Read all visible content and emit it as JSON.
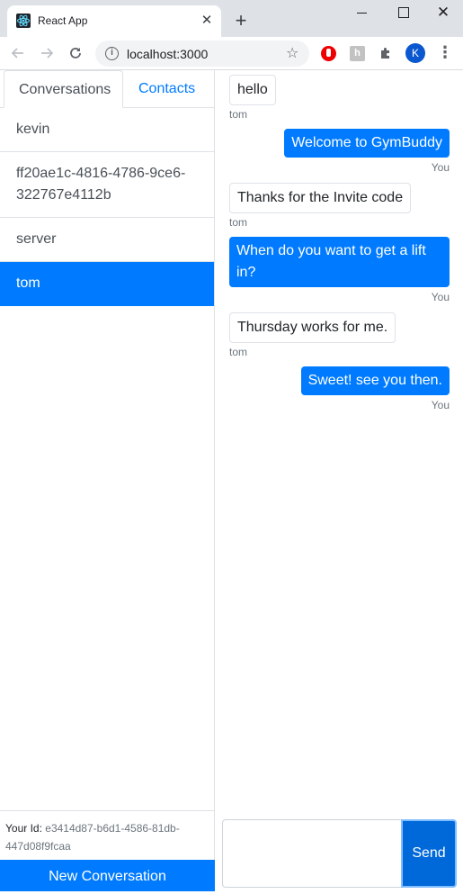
{
  "browser": {
    "tab_title": "React App",
    "url": "localhost:3000",
    "profile_initial": "K",
    "new_tab_glyph": "+",
    "close_glyph": "✕",
    "icons": {
      "favicon": "react-logo-icon",
      "back": "arrow-left-icon",
      "forward": "arrow-right-icon",
      "reload": "reload-icon",
      "info": "info-icon",
      "bookmark": "star-icon",
      "extensions": "puzzle-icon",
      "menu": "kebab-menu-icon"
    }
  },
  "sidebar": {
    "tabs": [
      {
        "label": "Conversations",
        "active": true
      },
      {
        "label": "Contacts",
        "active": false
      }
    ],
    "conversations": [
      {
        "name": "kevin",
        "active": false
      },
      {
        "name": "ff20ae1c-4816-4786-9ce6-322767e4112b",
        "active": false
      },
      {
        "name": "server",
        "active": false
      },
      {
        "name": "tom",
        "active": true
      }
    ],
    "your_id_label": "Your Id:",
    "your_id": "e3414d87-b6d1-4586-81db-447d08f9fcaa",
    "new_conversation_label": "New Conversation"
  },
  "chat": {
    "messages": [
      {
        "text": "hello",
        "sender": "tom",
        "from_me": false
      },
      {
        "text": "Welcome to GymBuddy",
        "sender": "You",
        "from_me": true
      },
      {
        "text": "Thanks for the Invite code",
        "sender": "tom",
        "from_me": false
      },
      {
        "text": "When do you want to get a lift in?",
        "sender": "You",
        "from_me": true
      },
      {
        "text": "Thursday works for me.",
        "sender": "tom",
        "from_me": false
      },
      {
        "text": "Sweet! see you then.",
        "sender": "You",
        "from_me": true
      }
    ],
    "composer_value": "",
    "send_label": "Send"
  },
  "colors": {
    "primary": "#007bff",
    "border": "#dee2e6",
    "muted": "#6c757d"
  }
}
